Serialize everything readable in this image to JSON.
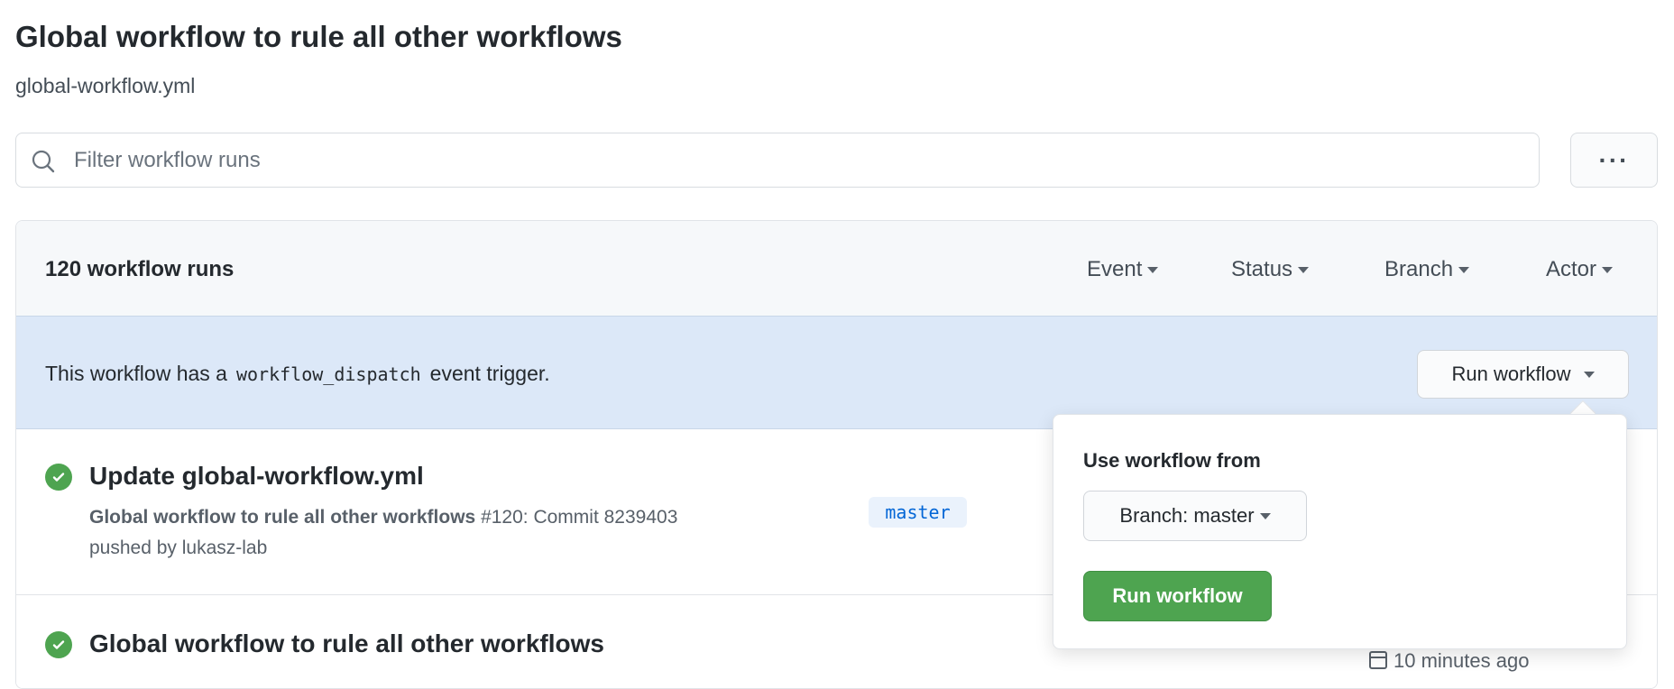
{
  "page": {
    "title": "Global workflow to rule all other workflows",
    "subtitle": "global-workflow.yml"
  },
  "search": {
    "placeholder": "Filter workflow runs",
    "value": "",
    "icon": "search-icon"
  },
  "more_button": {
    "label": "···",
    "icon": "kebab-horizontal-icon"
  },
  "runs_header": {
    "count_label": "120 workflow runs",
    "filters": [
      {
        "label": "Event"
      },
      {
        "label": "Status"
      },
      {
        "label": "Branch"
      },
      {
        "label": "Actor"
      }
    ]
  },
  "banner": {
    "text_before": "This workflow has a",
    "code": "workflow_dispatch",
    "text_after": "event trigger.",
    "run_button_label": "Run workflow"
  },
  "popover": {
    "label": "Use workflow from",
    "branch_select": "Branch: master",
    "run_button": "Run workflow"
  },
  "runs": [
    {
      "title": "Update global-workflow.yml",
      "workflow_name": "Global workflow to rule all other workflows",
      "detail": "#120: Commit 8239403",
      "pushed_by": "pushed by lukasz-lab",
      "branch": "master",
      "status": "success"
    },
    {
      "title": "Global workflow to rule all other workflows",
      "time": "10 minutes ago",
      "status": "success"
    }
  ],
  "colors": {
    "success": "#4ea450",
    "banner_bg": "#dce8f8",
    "link": "#0366d6"
  }
}
